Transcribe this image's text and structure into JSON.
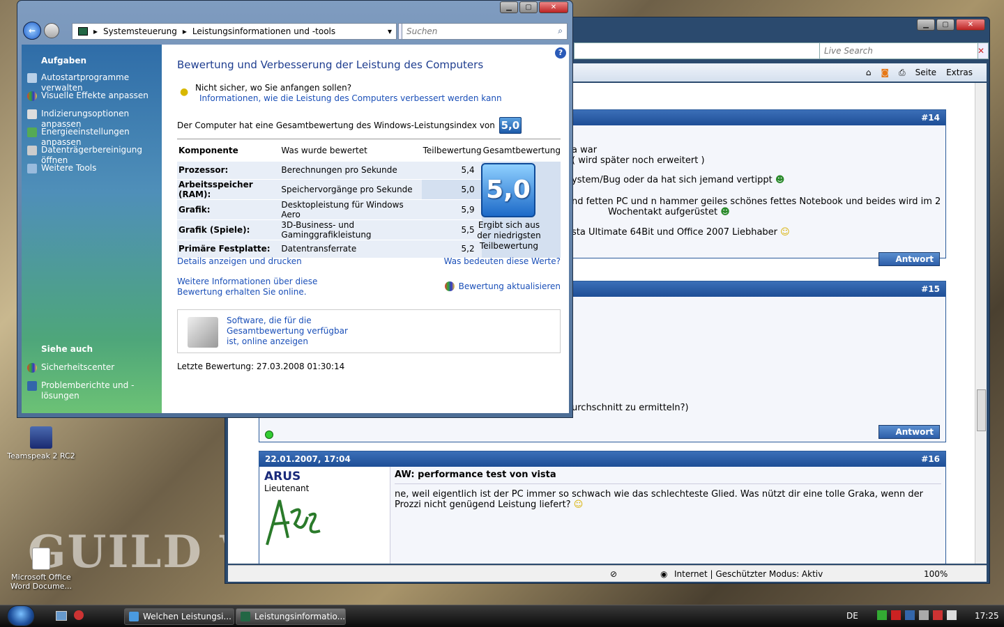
{
  "desktop": {
    "icons": [
      {
        "label": "Teamspeak 2 RC2"
      },
      {
        "label": "Microsoft Office Word Docume..."
      }
    ],
    "wallpaper_text": "GUILD WA"
  },
  "ie": {
    "search_placeholder": "Live Search",
    "cmd": {
      "page": "Seite",
      "tools": "Extras"
    },
    "status": "Internet | Geschützter Modus: Aktiv",
    "zoom": "100%",
    "posts": [
      {
        "num": "#14",
        "lines": [
          "a war",
          "( wird später noch erweitert )",
          "ystem/Bug oder da hat sich jemand vertippt",
          "nd fetten PC und n hammer geiles schönes fettes Notebook und beides wird im 2",
          "Wochentakt aufgerüstet",
          "sta Ultimate 64Bit und Office 2007 Liebhaber"
        ],
        "reply": "Antwort"
      },
      {
        "num": "#15",
        "lines": [
          "urchschnitt zu ermitteln?)"
        ],
        "reply": "Antwort"
      },
      {
        "num": "#16",
        "date": "22.01.2007, 17:04",
        "user": "ARUS",
        "rank": "Lieutenant",
        "title": "AW: performance test von vista",
        "text": "ne, weil eigentlich ist der PC immer so schwach wie das schlechteste Glied. Was nützt dir eine tolle Graka, wenn der Prozzi nicht genügend Leistung liefert?"
      }
    ]
  },
  "cp": {
    "breadcrumb": [
      "Systemsteuerung",
      "Leistungsinformationen und -tools"
    ],
    "search_placeholder": "Suchen",
    "sidebar": {
      "tasks_title": "Aufgaben",
      "tasks": [
        "Autostartprogramme verwalten",
        "Visuelle Effekte anpassen",
        "Indizierungsoptionen anpassen",
        "Energieeinstellungen anpassen",
        "Datenträgerbereinigung öffnen",
        "Weitere Tools"
      ],
      "see_also_title": "Siehe auch",
      "see_also": [
        "Sicherheitscenter",
        "Problemberichte und -lösungen"
      ]
    },
    "title": "Bewertung und Verbesserung der Leistung des Computers",
    "hint_question": "Nicht sicher, wo Sie anfangen sollen?",
    "hint_link": "Informationen, wie die Leistung des Computers verbessert werden kann",
    "overall_text": "Der Computer hat eine Gesamtbewertung des Windows-Leistungsindex von",
    "overall_score": "5,0",
    "table": {
      "headers": [
        "Komponente",
        "Was wurde bewertet",
        "Teilbewertung",
        "Gesamtbewertung"
      ],
      "rows": [
        {
          "component": "Prozessor:",
          "what": "Berechnungen pro Sekunde",
          "score": "5,4"
        },
        {
          "component": "Arbeitsspeicher (RAM):",
          "what": "Speichervorgänge pro Sekunde",
          "score": "5,0"
        },
        {
          "component": "Grafik:",
          "what": "Desktopleistung für Windows Aero",
          "score": "5,9"
        },
        {
          "component": "Grafik (Spiele):",
          "what": "3D-Business- und Gaminggrafikleistung",
          "score": "5,5"
        },
        {
          "component": "Primäre Festplatte:",
          "what": "Datentransferrate",
          "score": "5,2"
        }
      ],
      "big_score": "5,0",
      "big_caption": "Ergibt sich aus der niedrigsten Teilbewertung"
    },
    "link_details": "Details anzeigen und drucken",
    "link_meaning": "Was bedeuten diese Werte?",
    "link_online": "Weitere Informationen über diese Bewertung erhalten Sie online.",
    "link_update": "Bewertung aktualisieren",
    "software_text": "Software, die für die Gesamtbewertung verfügbar ist, online anzeigen",
    "last_rating": "Letzte Bewertung: 27.03.2008 01:30:14"
  },
  "taskbar": {
    "tasks": [
      "Welchen Leistungsi...",
      "Leistungsinformatio..."
    ],
    "lang": "DE",
    "time": "17:25"
  }
}
